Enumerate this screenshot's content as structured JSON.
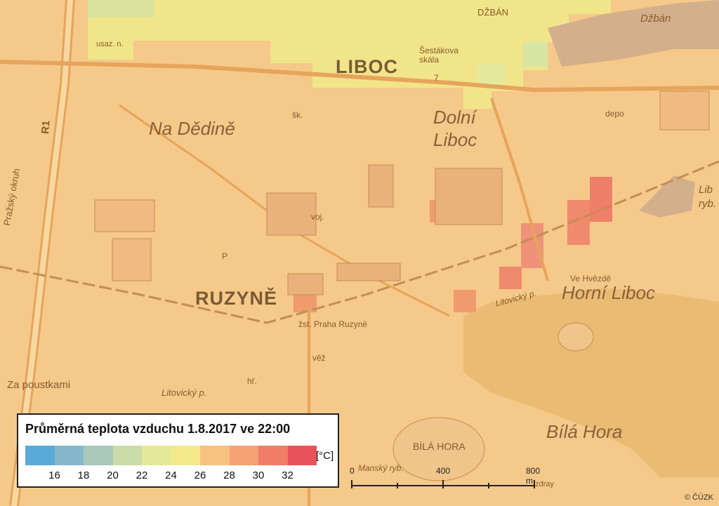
{
  "map": {
    "labels": {
      "liboc": "LIBOC",
      "ruzyne": "RUZYNĚ",
      "dzban_top": "DŽBÁN",
      "dzban_right": "Džbán",
      "na_dedine": "Na Dědině",
      "dolni_liboc_1": "Dolní",
      "dolni_liboc_2": "Liboc",
      "horni_liboc": "Horní Liboc",
      "bila_hora": "Bílá Hora",
      "bila_hora_caps": "BÍLÁ HORA",
      "za_poustkami": "Za poustkami",
      "prazsky_okruh": "Pražský okruh",
      "r1": "R1",
      "sestakova_1": "Šestákova",
      "sestakova_2": "skála",
      "zst_praha_ruzyne": "žst. Praha Ruzyně",
      "litovicky_1": "Litovický p.",
      "litovicky_2": "Litovický p.",
      "ve_hvezde": "Ve Hvězdě",
      "mansky": "Manský ryb.",
      "depo": "depo",
      "sk": "šk.",
      "hr": "hř.",
      "voj": "voj.",
      "vez": "věž",
      "usaz": "usaz. n.",
      "lib": "Lib",
      "ryb": "ryb.",
      "zdray": "zdray",
      "num7": "7",
      "parking": "P"
    }
  },
  "legend": {
    "title": "Průměrná teplota vzduchu 1.8.2017 ve 22:00",
    "unit": "[°C]",
    "colors": [
      "#5aaad8",
      "#86b7cc",
      "#a9c8b9",
      "#c9dcaa",
      "#e5e99a",
      "#f4e98a",
      "#f7c27f",
      "#f5a277",
      "#f07d66",
      "#e8535b"
    ],
    "ticks": [
      "16",
      "18",
      "20",
      "22",
      "24",
      "26",
      "28",
      "30",
      "32"
    ]
  },
  "scale": {
    "labels": [
      "0",
      "400",
      "800 m"
    ]
  },
  "copyright": "© ČÚZK"
}
